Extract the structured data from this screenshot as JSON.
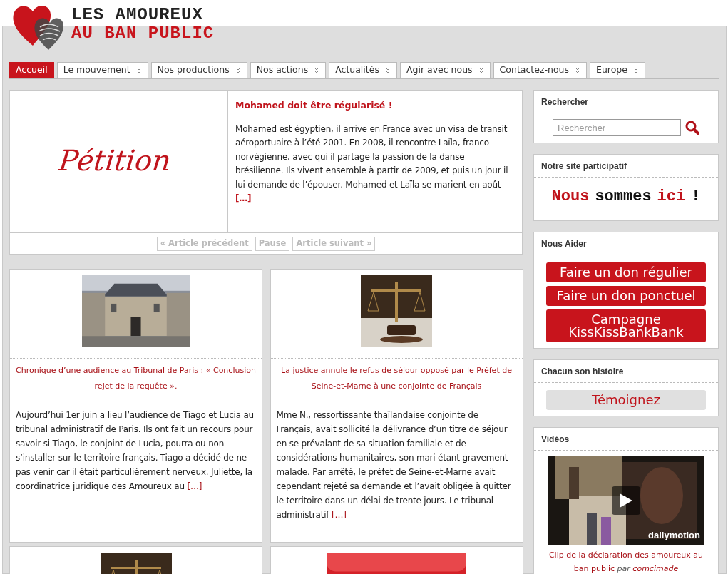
{
  "logo": {
    "line_1": "LES AMOUREUX",
    "line_2": "AU BAN PUBLIC"
  },
  "nav": [
    {
      "label": "Accueil",
      "selected": true,
      "submenu": false
    },
    {
      "label": "Le mouvement",
      "selected": false,
      "submenu": true
    },
    {
      "label": "Nos productions",
      "selected": false,
      "submenu": true
    },
    {
      "label": "Nos actions",
      "selected": false,
      "submenu": true
    },
    {
      "label": "Actualités",
      "selected": false,
      "submenu": true
    },
    {
      "label": "Agir avec nous",
      "selected": false,
      "submenu": true
    },
    {
      "label": "Contactez-nous",
      "selected": false,
      "submenu": true
    },
    {
      "label": "Europe",
      "selected": false,
      "submenu": true
    }
  ],
  "featured": {
    "image_text": "Pétition",
    "title": "Mohamed doit être régularisé !",
    "excerpt": "Mohamed est égyptien, il arrive en France avec un visa de transit aéroportuaire à l’été 2001. En 2008, il rencontre Laïla, franco-norvégienne, avec qui il partage la passion de la danse brésilienne. Ils vivent ensemble à partir de 2009, et puis un jour il lui demande de l’épouser. Mohamed et Laïla se marient en août",
    "more": "[…]",
    "controls": [
      "« Article précédent",
      "Pause",
      "Article suivant »"
    ]
  },
  "articles": [
    {
      "kind": "picture",
      "title": "Chronique d’une audience au Tribunal de Paris : « Conclusion rejet de la requête ».",
      "excerpt": "Aujourd’hui 1er juin a lieu l’audience de Tiago et Lucia au tribunal administratif de Paris. Ils ont fait un recours pour savoir si Tiago, le conjoint de Lucia, pourra ou non s’installer sur le territoire français. Tiago a décidé de ne pas venir car il était particulièrement nerveux. Juliette, la coordinatrice juridique des Amoureux au",
      "more": "[…]"
    },
    {
      "kind": "picture",
      "title": "La justice annule le refus de séjour opposé par le Préfet de Seine-et-Marne à une conjointe de Français",
      "excerpt": "Mme N., ressortissante thaïlandaise conjointe de Français, avait sollicité la délivrance d’un titre de séjour en se prévalant de sa situation familiale et de considérations humanitaires, son mari étant gravement malade. Par arrêté, le préfet de Seine-et-Marne avait cependant rejeté sa demande et l’avait obligée à quitter le territoire dans un délai de trente jours. Le tribunal administratif",
      "more": "[…]"
    },
    {
      "kind": "picture"
    },
    {
      "kind": "picture"
    }
  ],
  "sidebar": [
    {
      "kind": "search",
      "title": "Rechercher",
      "placeholder": "Rechercher"
    },
    {
      "kind": "logo",
      "title": "Notre site participatif",
      "parts": [
        {
          "text": "Nous",
          "color": "#c0141c"
        },
        {
          "text": "sommes",
          "color": "#111111"
        },
        {
          "text": "ici",
          "color": "#c0141c"
        },
        {
          "text": "!",
          "color": "#111111"
        }
      ]
    },
    {
      "kind": "buttons",
      "title": "Nous Aider",
      "buttons": [
        {
          "label": "Faire un don régulier"
        },
        {
          "label": "Faire un don ponctuel"
        },
        {
          "label": "Campagne KissKissBankBank"
        }
      ]
    },
    {
      "kind": "testimony",
      "title": "Chacun son histoire",
      "buttons": [
        {
          "label": "Témoignez"
        }
      ]
    },
    {
      "kind": "video",
      "title": "Vidéos",
      "brand": "dailymotion",
      "caption": "Clip de la déclaration des amoureux au ban public",
      "by": "par",
      "author": "comcimade"
    }
  ]
}
